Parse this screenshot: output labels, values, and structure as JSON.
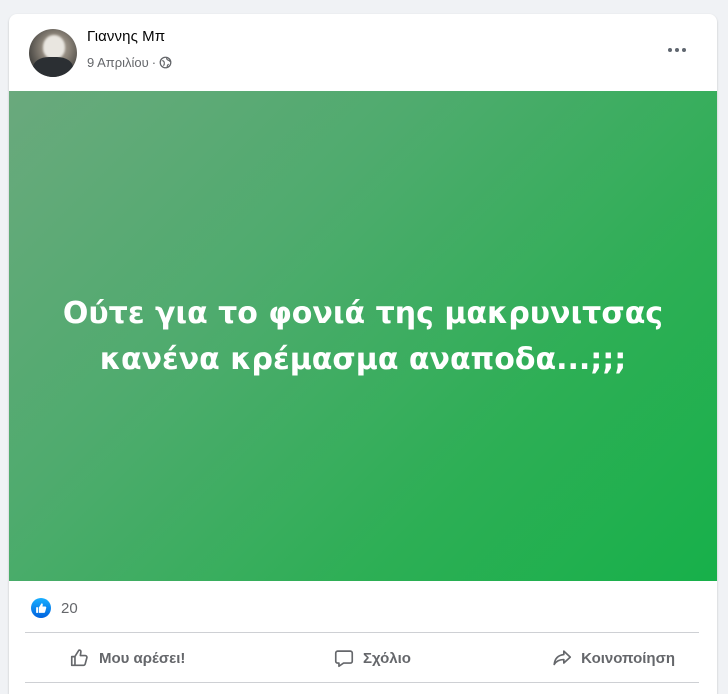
{
  "post": {
    "author": "Γιαννης Μπ",
    "date": "9 Απριλίου",
    "separator": "·",
    "privacy_icon": "globe-icon",
    "text_line_1": "Ούτε για το φονιά της μακρυνιτσας",
    "text_line_2": "κανένα κρέμασμα αναποδα...;;;",
    "background_gradient": [
      "#6aa97d",
      "#17b04a"
    ]
  },
  "reactions": {
    "icon": "like-icon",
    "count": "20",
    "color": "#0866ff"
  },
  "actions": {
    "like_label": "Μου αρέσει!",
    "comment_label": "Σχόλιο",
    "share_label": "Κοινοποίηση"
  },
  "colors": {
    "text_secondary": "#65676b",
    "divider": "#ced0d4",
    "page_bg": "#f0f2f5"
  }
}
